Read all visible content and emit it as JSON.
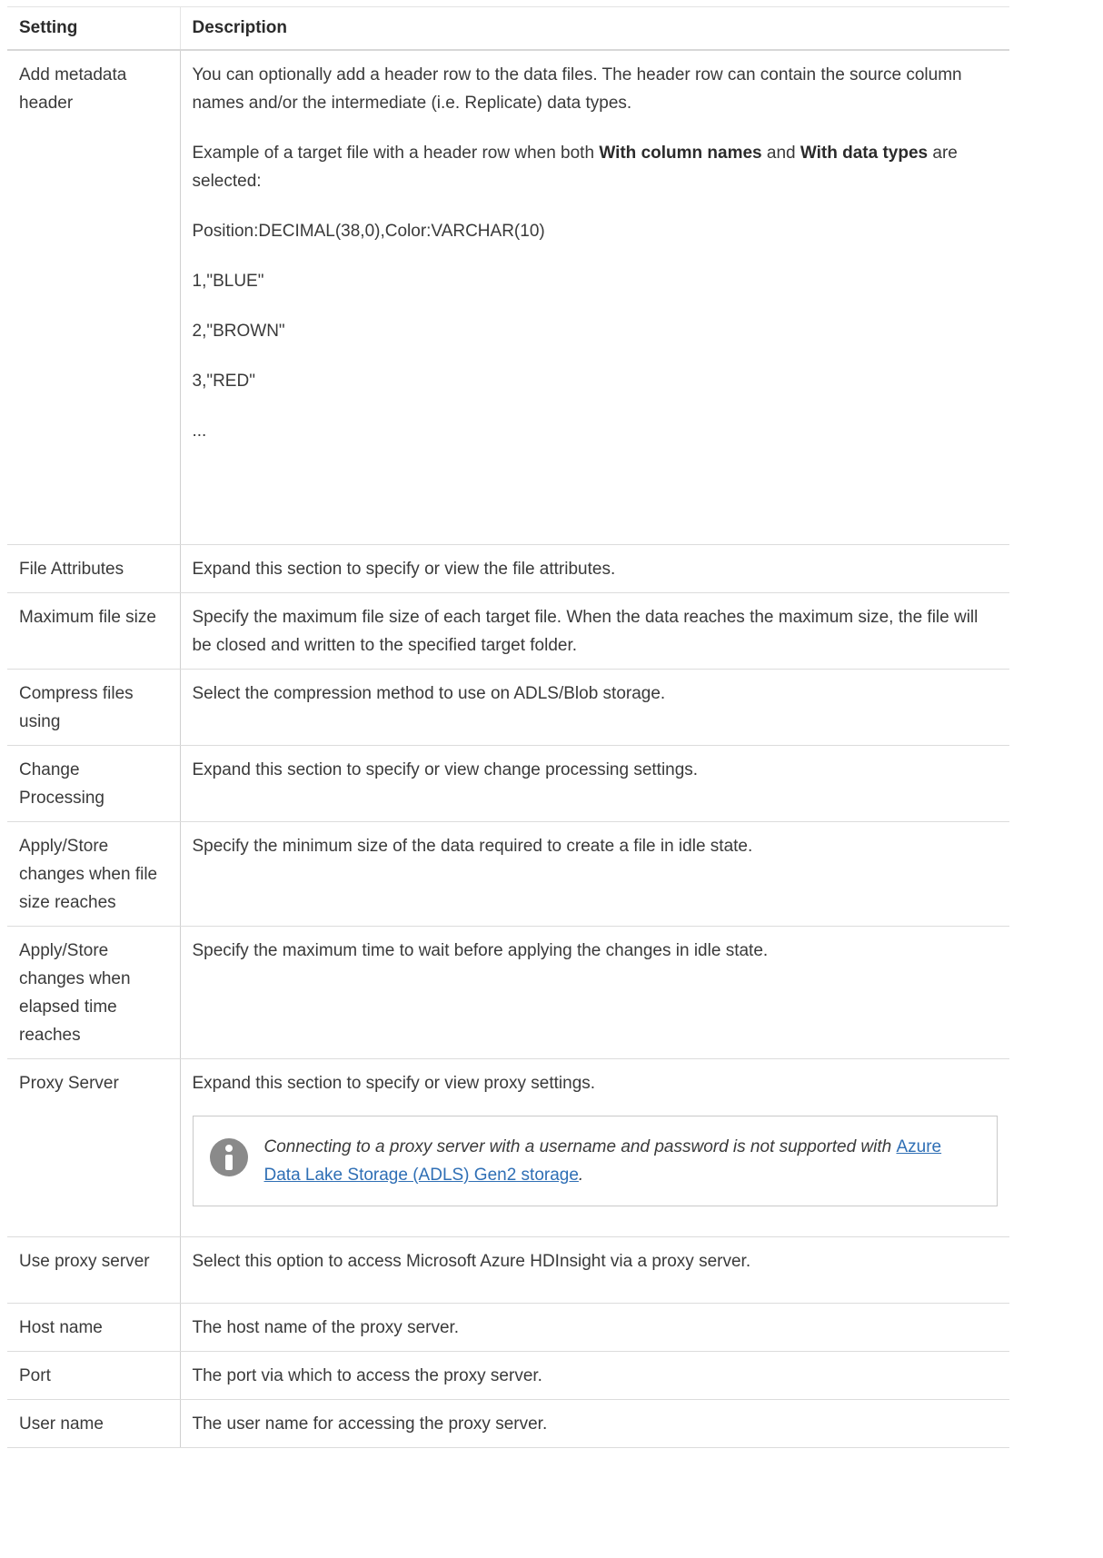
{
  "header": {
    "setting": "Setting",
    "description": "Description"
  },
  "metadata_row": {
    "setting": "Add metadata header",
    "para1": "You can optionally add a header row to the data files. The header row can contain the source column names and/or the intermediate (i.e. Replicate) data types.",
    "para2_prefix": "Example of a target file with a header row when both ",
    "para2_bold1": "With column names",
    "para2_mid": " and ",
    "para2_bold2": "With data types",
    "para2_suffix": " are selected:",
    "example_lines": [
      "Position:DECIMAL(38,0),Color:VARCHAR(10)",
      "1,\"BLUE\"",
      "2,\"BROWN\"",
      "3,\"RED\""
    ],
    "ellipsis": "..."
  },
  "rows": [
    {
      "setting": "File Attributes",
      "description": "Expand this section to specify or view the file attributes."
    },
    {
      "setting": "Maximum file size",
      "description": "Specify the maximum file size of each target file. When the data reaches the maximum size, the file will be closed and written to the specified target folder."
    },
    {
      "setting": "Compress files using",
      "description": "Select the compression method to use on ADLS/Blob storage."
    },
    {
      "setting": "Change Processing",
      "description": "Expand this section to specify or view change processing settings."
    },
    {
      "setting": "Apply/Store changes when file size reaches",
      "description": "Specify the minimum size of the data required to create a file in idle state."
    },
    {
      "setting": "Apply/Store changes when elapsed time reaches",
      "description": "Specify the maximum time to wait before applying the changes in idle state."
    }
  ],
  "proxy_row": {
    "setting": "Proxy Server",
    "description": "Expand this section to specify or view proxy settings.",
    "note_text": "Connecting to a proxy server with a username and password is not supported with ",
    "note_link": "Azure Data Lake Storage (ADLS) Gen2 storage",
    "note_end": "."
  },
  "rows2": [
    {
      "setting": "Use proxy server",
      "description": "Select this option to access Microsoft Azure HDInsight via a proxy server."
    },
    {
      "setting": "Host name",
      "description": "The host name of the proxy server."
    },
    {
      "setting": "Port",
      "description": "The port via which to access the proxy server."
    },
    {
      "setting": "User name",
      "description": "The user name for accessing the proxy server."
    }
  ],
  "colors": {
    "link": "#2f6fb5",
    "note_icon": "#8a8a8a",
    "border": "#dcdcdc"
  },
  "icons": {
    "note": "info-icon"
  }
}
